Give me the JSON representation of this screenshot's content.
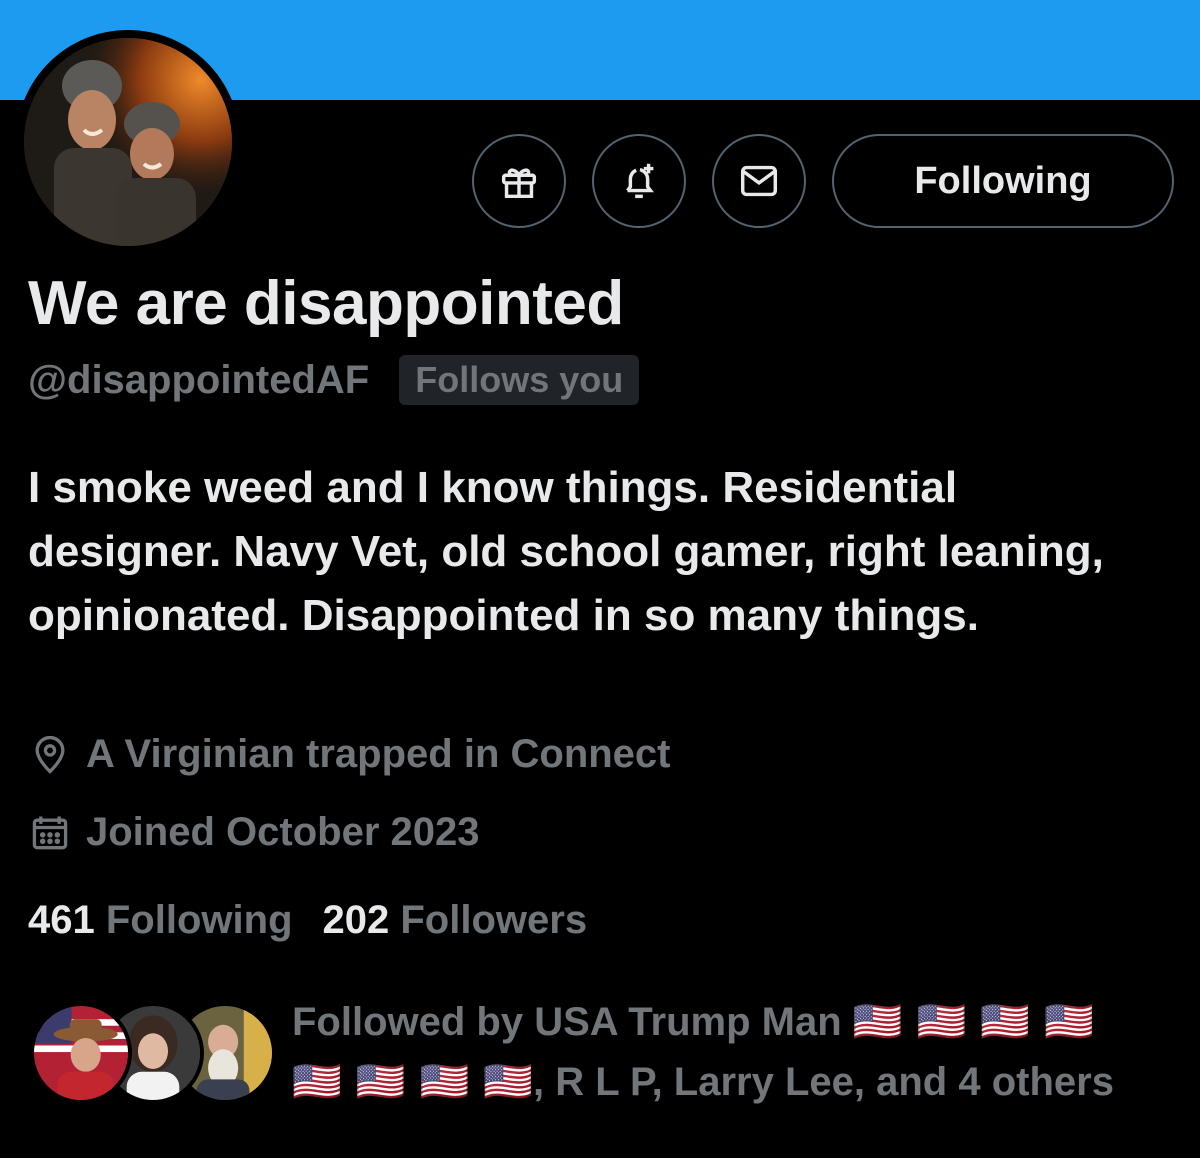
{
  "profile": {
    "display_name": "We are disappointed",
    "handle": "@disappointedAF",
    "follows_you_badge": "Follows you",
    "bio": "I smoke weed and I know things. Residential designer. Navy Vet, old school gamer, right leaning, opinionated. Disappointed in so many things.",
    "location": "A Virginian trapped in Connect",
    "joined": "Joined October 2023"
  },
  "actions": {
    "following_button": "Following",
    "icons": [
      "gift-icon",
      "notification-bell-plus-icon",
      "message-envelope-icon"
    ]
  },
  "stats": {
    "following_count": "461",
    "following_label": "Following",
    "followers_count": "202",
    "followers_label": "Followers"
  },
  "followed_by": {
    "prefix": "Followed by USA Trump Man",
    "flags_line1": "🇺🇸 🇺🇸 🇺🇸 🇺🇸",
    "flags_line2": "🇺🇸 🇺🇸 🇺🇸 🇺🇸",
    "suffix": ", R L P, Larry Lee, and 4 others"
  },
  "colors": {
    "banner": "#1d9bf0",
    "background": "#000000",
    "primary_text": "#e7e9ea",
    "secondary_text": "#71767b",
    "border": "#536471"
  }
}
